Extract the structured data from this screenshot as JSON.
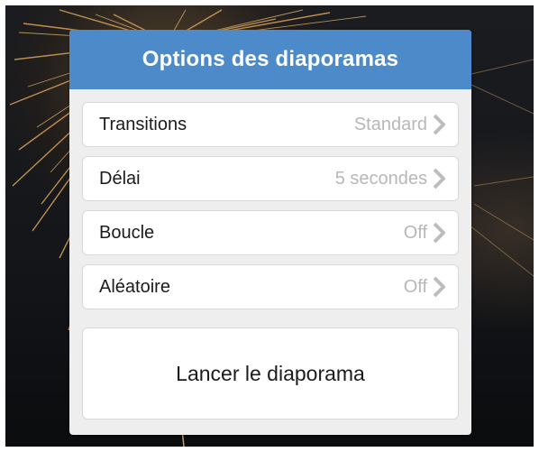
{
  "dialog": {
    "title": "Options des diaporamas",
    "header_color": "#4d8ac9",
    "options": [
      {
        "label": "Transitions",
        "value": "Standard",
        "icon": "chevron-right-icon"
      },
      {
        "label": "Délai",
        "value": "5 secondes",
        "icon": "chevron-right-icon"
      },
      {
        "label": "Boucle",
        "value": "Off",
        "icon": "chevron-right-icon"
      },
      {
        "label": "Aléatoire",
        "value": "Off",
        "icon": "chevron-right-icon"
      }
    ],
    "start_button_label": "Lancer le diaporama"
  }
}
